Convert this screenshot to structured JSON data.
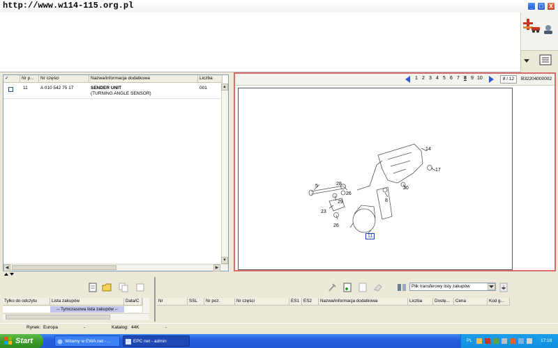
{
  "titlebar": {
    "url_text": "http://www.w114-115.org.pl",
    "minimize": "_",
    "maximize": "□",
    "close": "X"
  },
  "parts_table": {
    "columns": [
      "✓",
      "Nr p...",
      "Nr części",
      "Nazwa/informacja dodatkowa",
      "Liczba"
    ],
    "rows": [
      {
        "pos": "11",
        "part_number": "A 010 542 75 17",
        "name": "SENDER UNIT",
        "info": "(TURNING ANGLE SENSOR)",
        "qty": "001"
      }
    ]
  },
  "pager": {
    "pages": [
      "1",
      "2",
      "3",
      "4",
      "5",
      "6",
      "7",
      "8",
      "9",
      "10"
    ],
    "active_page": "8",
    "page_indicator": "8 / 12",
    "drawing_code": "B32204000002"
  },
  "drawing": {
    "callouts": [
      "14",
      "17",
      "20",
      "5",
      "28",
      "26",
      "29",
      "8",
      "23",
      "26",
      "11"
    ],
    "highlight_callout": "11",
    "line_color": "#555555",
    "highlight_color": "#1a3fa8"
  },
  "cart": {
    "columns": [
      "Tylko do odczytu",
      "Lista zakupów",
      "Data/C"
    ],
    "row_text": "-- Tymczasowa lista zakupów --"
  },
  "orders": {
    "transfer_select": "Plik transferowy listy zakupów",
    "columns": [
      "Nr",
      "SSL",
      "Nr poz.",
      "Nr części",
      "ES1",
      "ES2",
      "Nazwa/informacja dodatkowa",
      "Liczba",
      "Dostę...",
      "Cena",
      "Kod g..."
    ]
  },
  "statusbar": {
    "market_label": "Rynek:",
    "market_value": "Europa",
    "sep1": "-",
    "catalog_label": "Katalog:",
    "catalog_value": "44K",
    "sep2": "-"
  },
  "taskbar": {
    "start_label": "Start",
    "tasks": [
      "Witamy w EWA net - ...",
      "EPC net - admin"
    ],
    "tray_lang": "PL",
    "clock": "17:18"
  },
  "colors": {
    "selection_highlight": "#c4c8ef",
    "drawing_border": "#d96b6b",
    "taskbar_blue": "#245edc"
  }
}
